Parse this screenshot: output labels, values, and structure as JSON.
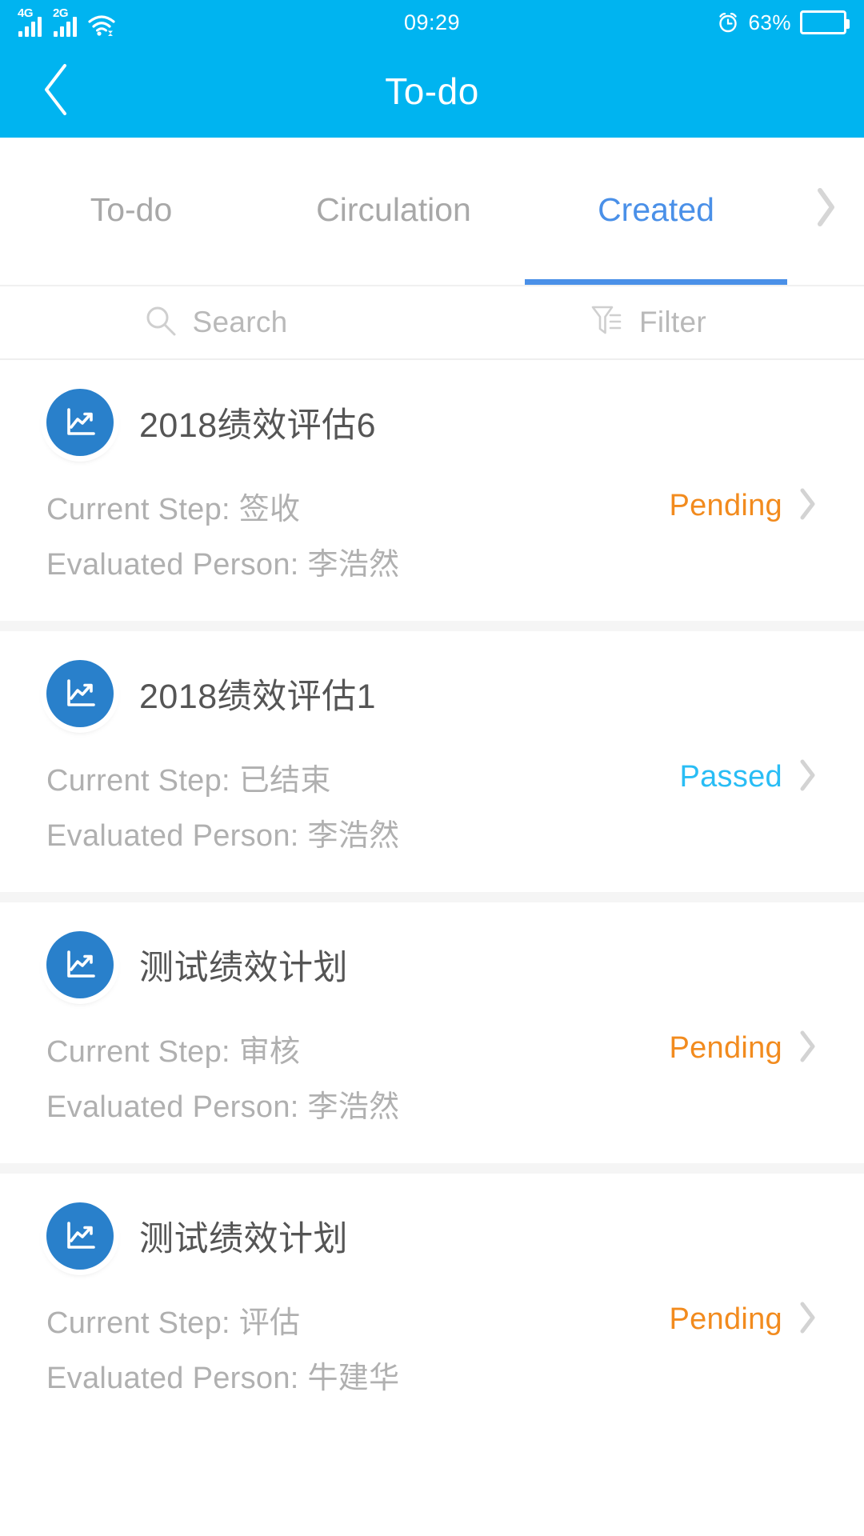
{
  "status_bar": {
    "network_primary": "4G",
    "network_secondary": "2G",
    "wifi_icon": "wifi-icon",
    "time": "09:29",
    "alarm_icon": "alarm-icon",
    "battery_percent": "63%",
    "battery_level": 63
  },
  "header": {
    "back_icon": "chevron-left-icon",
    "title": "To-do"
  },
  "tabs": {
    "items": [
      {
        "label": "To-do",
        "active": false
      },
      {
        "label": "Circulation",
        "active": false
      },
      {
        "label": "Created",
        "active": true
      }
    ],
    "more_icon": "chevron-right-icon",
    "active_color": "#4a90e8",
    "inactive_color": "#a8a8a8"
  },
  "toolbar": {
    "search_icon": "search-icon",
    "search_label": "Search",
    "filter_icon": "filter-icon",
    "filter_label": "Filter"
  },
  "list": {
    "labels": {
      "current_step": "Current Step:",
      "evaluated_person": "Evaluated Person:"
    },
    "item_icon": "line-chart-icon",
    "chevron_icon": "chevron-right-icon",
    "status_colors": {
      "pending": "#f28b1e",
      "passed": "#29bdf5"
    },
    "items": [
      {
        "title": "2018绩效评估6",
        "current_step_label": "Current Step:",
        "current_step_value": "签收",
        "evaluated_person_label": "Evaluated Person:",
        "evaluated_person_value": "李浩然",
        "status": "Pending",
        "status_type": "pending"
      },
      {
        "title": "2018绩效评估1",
        "current_step_label": "Current Step:",
        "current_step_value": "已结束",
        "evaluated_person_label": "Evaluated Person:",
        "evaluated_person_value": "李浩然",
        "status": "Passed",
        "status_type": "passed"
      },
      {
        "title": "测试绩效计划",
        "current_step_label": "Current Step:",
        "current_step_value": "审核",
        "evaluated_person_label": "Evaluated Person:",
        "evaluated_person_value": "李浩然",
        "status": "Pending",
        "status_type": "pending"
      },
      {
        "title": "测试绩效计划",
        "current_step_label": "Current Step:",
        "current_step_value": "评估",
        "evaluated_person_label": "Evaluated Person:",
        "evaluated_person_value": "牛建华",
        "status": "Pending",
        "status_type": "pending"
      }
    ]
  }
}
